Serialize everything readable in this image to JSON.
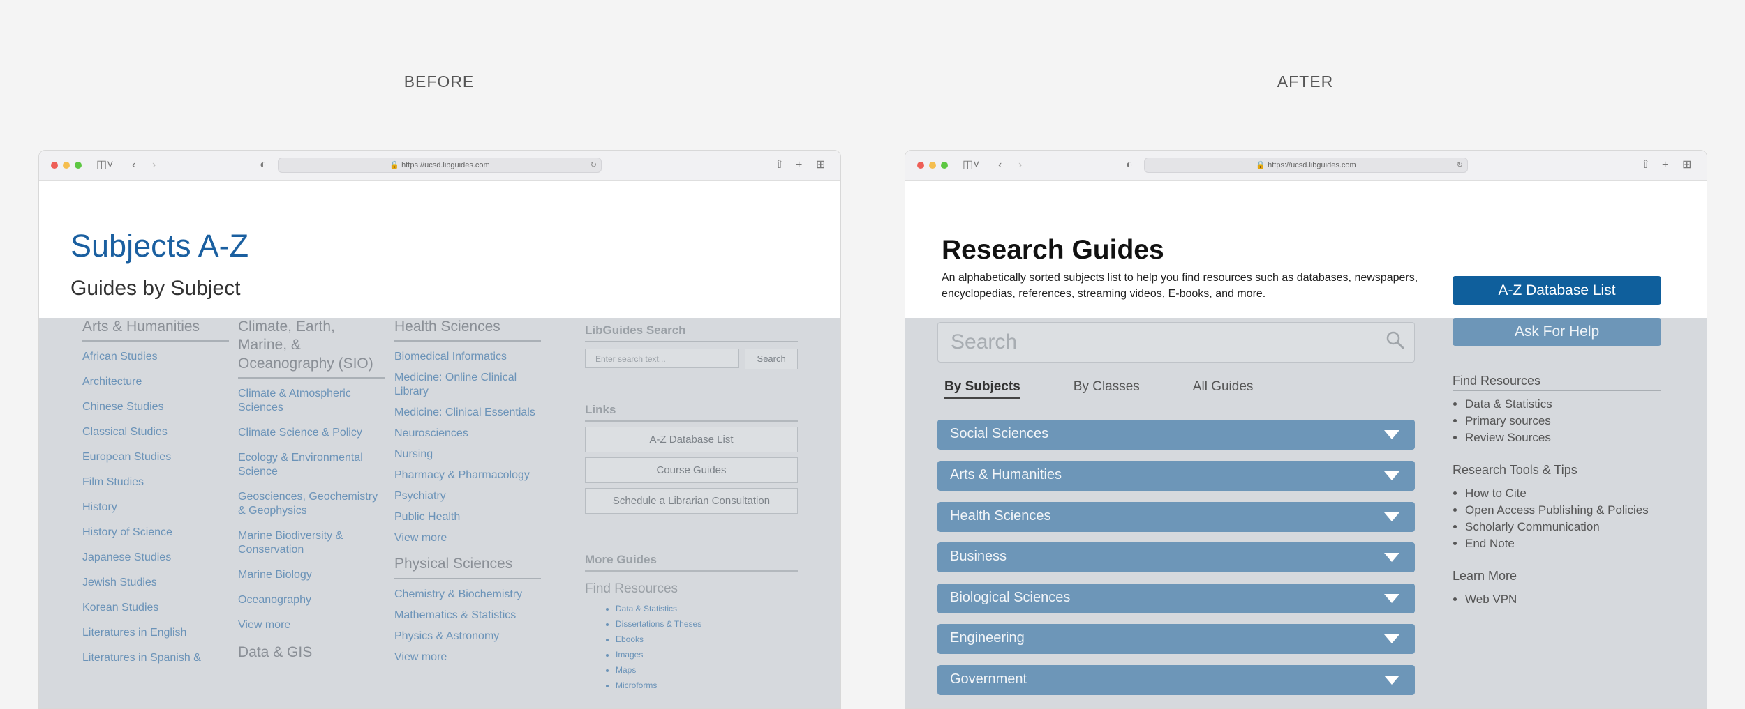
{
  "labels": {
    "before": "BEFORE",
    "after": "AFTER"
  },
  "browser": {
    "url": "https://ucsd.libguides.com"
  },
  "before": {
    "title": "Subjects A-Z",
    "subtitle": "Guides by Subject",
    "columns": [
      {
        "heading": "Arts & Humanities",
        "links": [
          "African Studies",
          "Architecture",
          "Chinese Studies",
          "Classical Studies",
          "European Studies",
          "Film Studies",
          "History",
          "History of Science",
          "Japanese Studies",
          "Jewish Studies",
          "Korean Studies",
          "Literatures in English",
          "Literatures in Spanish &"
        ]
      },
      {
        "heading": "Climate, Earth, Marine, & Oceanography (SIO)",
        "links": [
          "Climate & Atmospheric Sciences",
          "Climate Science & Policy",
          "Ecology & Environmental Science",
          "Geosciences, Geochemistry & Geophysics",
          "Marine Biodiversity & Conservation",
          "Marine Biology",
          "Oceanography",
          "View more"
        ],
        "heading2": "Data & GIS"
      },
      {
        "heading": "Health Sciences",
        "links": [
          "Biomedical Informatics",
          "Medicine: Online Clinical Library",
          "Medicine: Clinical Essentials",
          "Neurosciences",
          "Nursing",
          "Pharmacy & Pharmacology",
          "Psychiatry",
          "Public Health",
          "View more"
        ],
        "heading2": "Physical Sciences",
        "links2": [
          "Chemistry & Biochemistry",
          "Mathematics & Statistics",
          "Physics & Astronomy",
          "View more"
        ]
      }
    ],
    "sidebar": {
      "search_heading": "LibGuides Search",
      "search_placeholder": "Enter search text...",
      "search_button": "Search",
      "links_heading": "Links",
      "links": [
        "A-Z Database List",
        "Course Guides",
        "Schedule a Librarian Consultation"
      ],
      "more_heading": "More Guides",
      "find_heading": "Find Resources",
      "find_items": [
        "Data & Statistics",
        "Dissertations & Theses",
        "Ebooks",
        "Images",
        "Maps",
        "Microforms"
      ]
    }
  },
  "after": {
    "title": "Research Guides",
    "description": "An alphabetically sorted subjects list to help you find resources such as databases, newspapers, encyclopedias, references, streaming videos, E-books, and more.",
    "search_placeholder": "Search",
    "tabs": [
      "By Subjects",
      "By Classes",
      "All Guides"
    ],
    "active_tab": "By Subjects",
    "accordions": [
      "Social Sciences",
      "Arts & Humanities",
      "Health Sciences",
      "Business",
      "Biological Sciences",
      "Engineering",
      "Government"
    ],
    "primary_button": "A-Z Database List",
    "secondary_button": "Ask For Help",
    "sidebar": [
      {
        "heading": "Find Resources",
        "items": [
          "Data & Statistics",
          "Primary sources",
          "Review Sources"
        ]
      },
      {
        "heading": "Research Tools & Tips",
        "items": [
          "How to Cite",
          "Open Access Publishing & Policies",
          "Scholarly Communication",
          "End Note"
        ]
      },
      {
        "heading": "Learn More",
        "items": [
          "Web VPN"
        ]
      }
    ]
  },
  "colors": {
    "accent": "#0f5f9c",
    "accordion": "#6d96b8",
    "overlay": "#d6d9dd",
    "before_title": "#1a5fa0"
  }
}
